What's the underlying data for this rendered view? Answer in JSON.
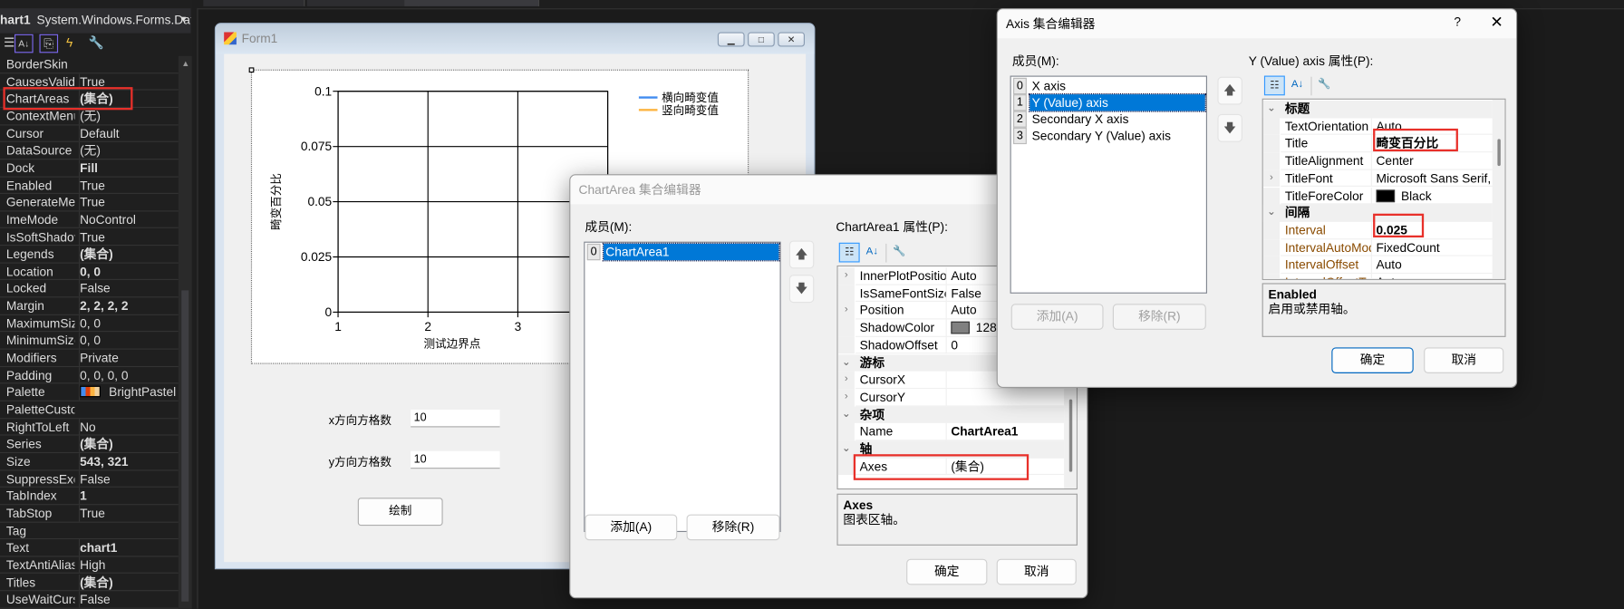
{
  "properties_panel": {
    "object_name": "hart1",
    "object_type": "System.Windows.Forms.Dat",
    "rows": [
      {
        "name": "BorderSkin",
        "value": ""
      },
      {
        "name": "CausesValida",
        "value": "True"
      },
      {
        "name": "ChartAreas",
        "value": "(集合)",
        "bold": true
      },
      {
        "name": "ContextMenu",
        "value": "(无)"
      },
      {
        "name": "Cursor",
        "value": "Default"
      },
      {
        "name": "DataSource",
        "value": "(无)"
      },
      {
        "name": "Dock",
        "value": "Fill",
        "bold": true
      },
      {
        "name": "Enabled",
        "value": "True"
      },
      {
        "name": "GenerateMer",
        "value": "True"
      },
      {
        "name": "ImeMode",
        "value": "NoControl"
      },
      {
        "name": "IsSoftShadov",
        "value": "True"
      },
      {
        "name": "Legends",
        "value": "(集合)",
        "bold": true
      },
      {
        "name": "Location",
        "value": "0, 0",
        "bold": true
      },
      {
        "name": "Locked",
        "value": "False"
      },
      {
        "name": "Margin",
        "value": "2, 2, 2, 2",
        "bold": true
      },
      {
        "name": "MaximumSize",
        "value": "0, 0"
      },
      {
        "name": "MinimumSize",
        "value": "0, 0"
      },
      {
        "name": "Modifiers",
        "value": "Private"
      },
      {
        "name": "Padding",
        "value": "0, 0, 0, 0"
      },
      {
        "name": "Palette",
        "value": "BrightPastel",
        "swatch": [
          "#418cf0",
          "#e0400a",
          "#fcb441",
          "#f0d2a0"
        ]
      },
      {
        "name": "PaletteCustor",
        "value": ""
      },
      {
        "name": "RightToLeft",
        "value": "No"
      },
      {
        "name": "Series",
        "value": "(集合)",
        "bold": true
      },
      {
        "name": "Size",
        "value": "543, 321",
        "bold": true
      },
      {
        "name": "SuppressExc",
        "value": "False"
      },
      {
        "name": "TabIndex",
        "value": "1",
        "bold": true
      },
      {
        "name": "TabStop",
        "value": "True"
      },
      {
        "name": "Tag",
        "value": ""
      },
      {
        "name": "Text",
        "value": "chart1",
        "bold": true
      },
      {
        "name": "TextAntiAlias",
        "value": "High"
      },
      {
        "name": "Titles",
        "value": "(集合)",
        "bold": true
      },
      {
        "name": "UseWaitCurs",
        "value": "False"
      }
    ]
  },
  "form1": {
    "title": "Form1",
    "x_grid_label": "x方向方格数",
    "x_grid_value": "10",
    "y_grid_label": "y方向方格数",
    "y_grid_value": "10",
    "draw_button": "绘制"
  },
  "chart_data": {
    "type": "line",
    "xlabel": "测试边界点",
    "ylabel": "畸变百分比",
    "x_ticks": [
      "1",
      "2",
      "3"
    ],
    "x_tick_values": [
      1,
      2,
      3
    ],
    "xlim": [
      1,
      4
    ],
    "y_ticks": [
      "0.1",
      "0.075",
      "0.05",
      "0.025",
      "0"
    ],
    "y_tick_values": [
      0.1,
      0.075,
      0.05,
      0.025,
      0
    ],
    "ylim": [
      0,
      0.1
    ],
    "grid": true,
    "legend_position": "top-right",
    "series": [
      {
        "name": "横向畸变值",
        "color": "#418cf0",
        "values": []
      },
      {
        "name": "竖向畸变值",
        "color": "#fcb441",
        "values": []
      }
    ]
  },
  "chartarea_editor": {
    "title": "ChartArea 集合编辑器",
    "members_label": "成员(M):",
    "members": [
      {
        "index": "0",
        "name": "ChartArea1",
        "selected": true
      }
    ],
    "props_label": "ChartArea1 属性(P):",
    "rows": [
      {
        "name": "InnerPlotPositior",
        "value": "Auto",
        "expand": true
      },
      {
        "name": "IsSameFontSizeF",
        "value": "False"
      },
      {
        "name": "Position",
        "value": "Auto",
        "expand": true
      },
      {
        "name": "ShadowColor",
        "value": "128,",
        "swatch": "#808080"
      },
      {
        "name": "ShadowOffset",
        "value": "0"
      },
      {
        "cat": true,
        "name": "游标"
      },
      {
        "name": "CursorX",
        "value": "",
        "expand": true
      },
      {
        "name": "CursorY",
        "value": "",
        "expand": true
      },
      {
        "cat": true,
        "name": "杂项"
      },
      {
        "name": "Name",
        "value": "ChartArea1",
        "bold": true
      },
      {
        "cat": true,
        "name": "轴"
      },
      {
        "name": "Axes",
        "value": "(集合)"
      }
    ],
    "desc_title": "Axes",
    "desc_text": "图表区轴。",
    "add": "添加(A)",
    "remove": "移除(R)",
    "ok": "确定",
    "cancel": "取消"
  },
  "axis_editor": {
    "title": "Axis 集合编辑器",
    "help": "?",
    "members_label": "成员(M):",
    "members": [
      {
        "index": "0",
        "name": "X axis"
      },
      {
        "index": "1",
        "name": "Y (Value) axis",
        "selected": true
      },
      {
        "index": "2",
        "name": "Secondary X axis"
      },
      {
        "index": "3",
        "name": "Secondary Y (Value) axis"
      }
    ],
    "props_label": "Y (Value) axis 属性(P):",
    "rows": [
      {
        "cat": true,
        "name": "标题"
      },
      {
        "name": "TextOrientation",
        "value": "Auto"
      },
      {
        "name": "Title",
        "value": "畸变百分比",
        "bold": true
      },
      {
        "name": "TitleAlignment",
        "value": "Center"
      },
      {
        "name": "TitleFont",
        "value": "Microsoft Sans Serif,",
        "expand": true
      },
      {
        "name": "TitleForeColor",
        "value": "Black",
        "swatch": "#000000"
      },
      {
        "cat": true,
        "name": "间隔"
      },
      {
        "name": "Interval",
        "value": "0.025",
        "bold": true,
        "modified": true
      },
      {
        "name": "IntervalAutoMod",
        "value": "FixedCount",
        "modified": true
      },
      {
        "name": "IntervalOffset",
        "value": "Auto",
        "modified": true
      },
      {
        "name": "IntervalOffsetT",
        "value": "Auto",
        "modified": true
      }
    ],
    "desc_title": "Enabled",
    "desc_text": "启用或禁用轴。",
    "add": "添加(A)",
    "remove": "移除(R)",
    "ok": "确定",
    "cancel": "取消"
  },
  "colors": {
    "accent": "#0078d7",
    "highlight": "#e8302a"
  }
}
